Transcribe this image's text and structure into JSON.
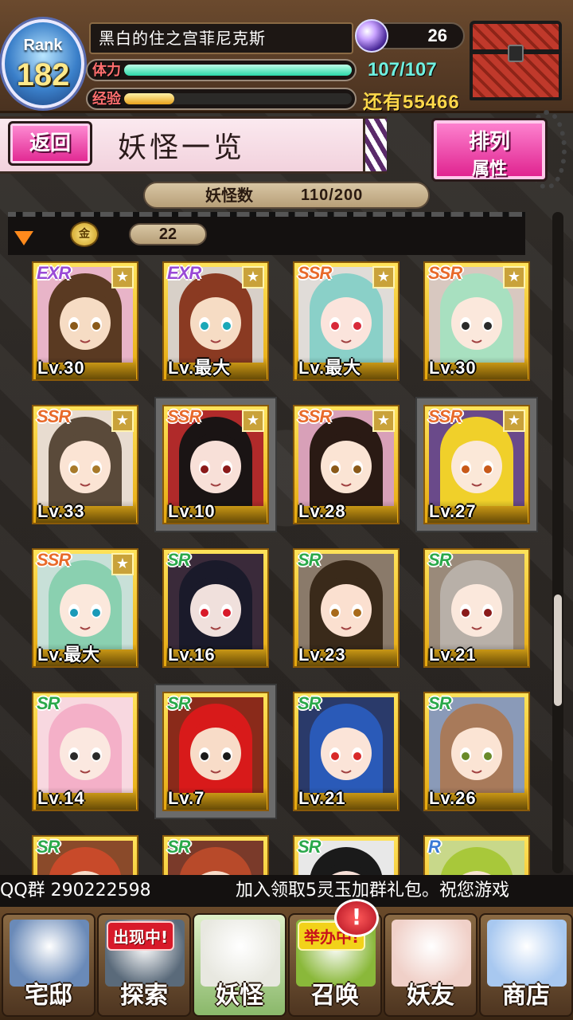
{
  "header": {
    "rank_label": "Rank",
    "rank_value": "182",
    "player_name": "黑白的住之宫菲尼克斯",
    "orb_count": "26",
    "stamina_label": "体力",
    "stamina_text": "107/107",
    "stamina_fraction": 1.0,
    "exp_label": "经验",
    "exp_fraction": 0.22,
    "exp_remaining": "还有55466"
  },
  "title_bar": {
    "back_label": "返回",
    "title": "妖怪一览",
    "sort_line1": "排列",
    "sort_line2": "属性"
  },
  "count": {
    "label": "妖怪数",
    "value": "110/200"
  },
  "filter": {
    "coin_glyph": "金",
    "count": "22"
  },
  "cards": [
    {
      "rarity": "EXR",
      "level": "Lv.30",
      "star": "★",
      "hair": "#5a3a22",
      "skin": "#f6dcc4",
      "eyes": "#8a5a1a",
      "bg": "#e8b4c8"
    },
    {
      "rarity": "EXR",
      "level": "Lv.最大",
      "star": "★",
      "hair": "#8a3a22",
      "skin": "#f6dcc4",
      "eyes": "#1aa8b8",
      "bg": "#d8d0c8"
    },
    {
      "rarity": "SSR",
      "level": "Lv.最大",
      "star": "★",
      "hair": "#8ad0c8",
      "skin": "#fbe4dc",
      "eyes": "#d82a3a",
      "bg": "#e0dcd8"
    },
    {
      "rarity": "SSR",
      "level": "Lv.30",
      "star": "★",
      "hair": "#a8e0c0",
      "skin": "#fbe8dc",
      "eyes": "#2a2a2a",
      "bg": "#d8c8c0"
    },
    {
      "rarity": "SSR",
      "level": "Lv.33",
      "star": "★",
      "hair": "#5a4a3a",
      "skin": "#fbe4d4",
      "eyes": "#a87a2a",
      "bg": "#e8dcd0"
    },
    {
      "rarity": "SSR",
      "level": "Lv.10",
      "star": "★",
      "hair": "#1a1414",
      "skin": "#f8e0d8",
      "eyes": "#8a1a1a",
      "bg": "#b02a2a",
      "selected": true
    },
    {
      "rarity": "SSR",
      "level": "Lv.28",
      "star": "★",
      "hair": "#2a1a14",
      "skin": "#fbe4d4",
      "eyes": "#8a5a1a",
      "bg": "#d8a0b8"
    },
    {
      "rarity": "SSR",
      "level": "Lv.27",
      "star": "★",
      "hair": "#f0d02a",
      "skin": "#fbe8d8",
      "eyes": "#c85a1a",
      "bg": "#6a4a8a",
      "selected": true
    },
    {
      "rarity": "SSR",
      "level": "Lv.最大",
      "star": "★",
      "hair": "#8ad0b0",
      "skin": "#fbe8dc",
      "eyes": "#1a9ab8",
      "bg": "#c8e0d8"
    },
    {
      "rarity": "SR",
      "level": "Lv.16",
      "star": "",
      "hair": "#1a1a2a",
      "skin": "#f0e0dc",
      "eyes": "#d81a2a",
      "bg": "#3a2a3a"
    },
    {
      "rarity": "SR",
      "level": "Lv.23",
      "star": "",
      "hair": "#3a2a1a",
      "skin": "#fbe0d0",
      "eyes": "#a86a1a",
      "bg": "#8a7a6a"
    },
    {
      "rarity": "SR",
      "level": "Lv.21",
      "star": "",
      "hair": "#b8b0a8",
      "skin": "#fbe8dc",
      "eyes": "#8a1a1a",
      "bg": "#9a8a7a"
    },
    {
      "rarity": "SR",
      "level": "Lv.14",
      "star": "",
      "hair": "#f4b0c8",
      "skin": "#fbe8e0",
      "eyes": "#2a2a2a",
      "bg": "#f8d8e0"
    },
    {
      "rarity": "SR",
      "level": "Lv.7",
      "star": "",
      "hair": "#d81a1a",
      "skin": "#f8dcc8",
      "eyes": "#1a1a1a",
      "bg": "#8a2a1a",
      "selected": true
    },
    {
      "rarity": "SR",
      "level": "Lv.21",
      "star": "",
      "hair": "#2a5ab8",
      "skin": "#fbe4d8",
      "eyes": "#d82a2a",
      "bg": "#2a3a6a"
    },
    {
      "rarity": "SR",
      "level": "Lv.26",
      "star": "",
      "hair": "#a87a5a",
      "skin": "#fbe4d4",
      "eyes": "#6a8a2a",
      "bg": "#8a9ab8"
    },
    {
      "rarity": "SR",
      "level": "",
      "star": "",
      "hair": "#c84a2a",
      "skin": "#f8dcc8",
      "eyes": "#2a2a2a",
      "bg": "#8a4a2a"
    },
    {
      "rarity": "SR",
      "level": "",
      "star": "",
      "hair": "#b84a2a",
      "skin": "#f8dcc8",
      "eyes": "#2a2a2a",
      "bg": "#7a3a2a"
    },
    {
      "rarity": "SR",
      "level": "",
      "star": "",
      "hair": "#1a1a1a",
      "skin": "#f8e0d8",
      "eyes": "#2a2a2a",
      "bg": "#e8e8e8"
    },
    {
      "rarity": "R",
      "level": "",
      "star": "",
      "hair": "#a8c83a",
      "skin": "#f8e4d0",
      "eyes": "#2a2a2a",
      "bg": "#c8d88a"
    }
  ],
  "ticker": {
    "group_text": "QQ群 290222598",
    "message": "加入领取5灵玉加群礼包。祝您游戏"
  },
  "nav": [
    {
      "label": "宅邸",
      "badge": "",
      "art": "#6a8ab8"
    },
    {
      "label": "探索",
      "badge": "出现中!",
      "art": "#5a6a7a"
    },
    {
      "label": "妖怪",
      "badge": "",
      "art": "#e8e8e0"
    },
    {
      "label": "召唤",
      "badge": "举办中!",
      "art": "#8ab83a"
    },
    {
      "label": "妖友",
      "badge": "",
      "art": "#f0d0c8"
    },
    {
      "label": "商店",
      "badge": "",
      "art": "#a8c8f0"
    }
  ],
  "nav_alert": "!"
}
